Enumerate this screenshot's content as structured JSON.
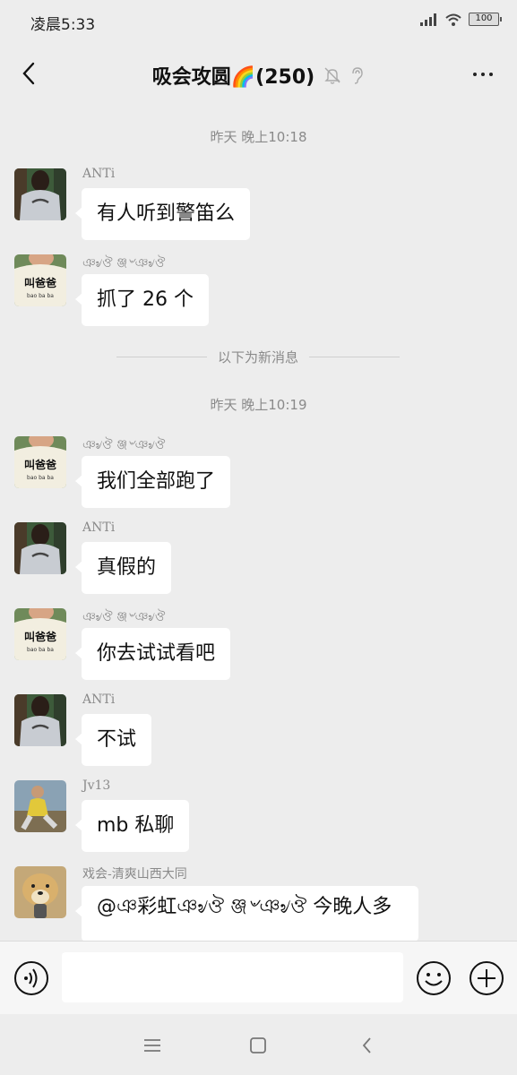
{
  "status_bar": {
    "time": "凌晨5:33",
    "battery": "100"
  },
  "header": {
    "title": "吸会攻圆🌈(250)"
  },
  "timestamps": [
    "昨天 晚上10:18",
    "昨天 晚上10:19"
  ],
  "divider_text": "以下为新消息",
  "messages": [
    {
      "sender": "ANTi",
      "text": "有人听到警笛么",
      "avatar": "avatar-anti"
    },
    {
      "sender": "ঞ৶ঔ ঞ্জ৺ঞ৶ঔ",
      "text": "抓了 26 个",
      "avatar": "avatar-baba"
    },
    {
      "sender": "ঞ৶ঔ ঞ্জ৺ঞ৶ঔ",
      "text": "我们全部跑了",
      "avatar": "avatar-baba"
    },
    {
      "sender": "ANTi",
      "text": "真假的",
      "avatar": "avatar-anti"
    },
    {
      "sender": "ঞ৶ঔ ঞ্জ৺ঞ৶ঔ",
      "text": "你去试试看吧",
      "avatar": "avatar-baba"
    },
    {
      "sender": "ANTi",
      "text": "不试",
      "avatar": "avatar-anti"
    },
    {
      "sender": "Jv13",
      "text": "mb 私聊",
      "avatar": "avatar-jv13"
    },
    {
      "sender": "戏会-清爽山西大同",
      "text": "@ঞ彩虹ঞ৶ঔ ঞ্জ৺ঞ৶ঔ 今晚人多",
      "avatar": "avatar-dog"
    }
  ],
  "avatar_texts": {
    "baba": "叫爸爸",
    "baba_sub": "bao  ba   ba"
  },
  "input": {
    "placeholder": ""
  },
  "icons": {
    "back": "chevron-left-icon",
    "mute": "bell-off-icon",
    "earpiece": "ear-icon",
    "more": "more-icon",
    "voice": "voice-icon",
    "emoji": "emoji-icon",
    "plus": "plus-icon"
  },
  "colors": {
    "background": "#ededed",
    "bubble": "#ffffff",
    "meta_text": "#8a8a8a"
  }
}
